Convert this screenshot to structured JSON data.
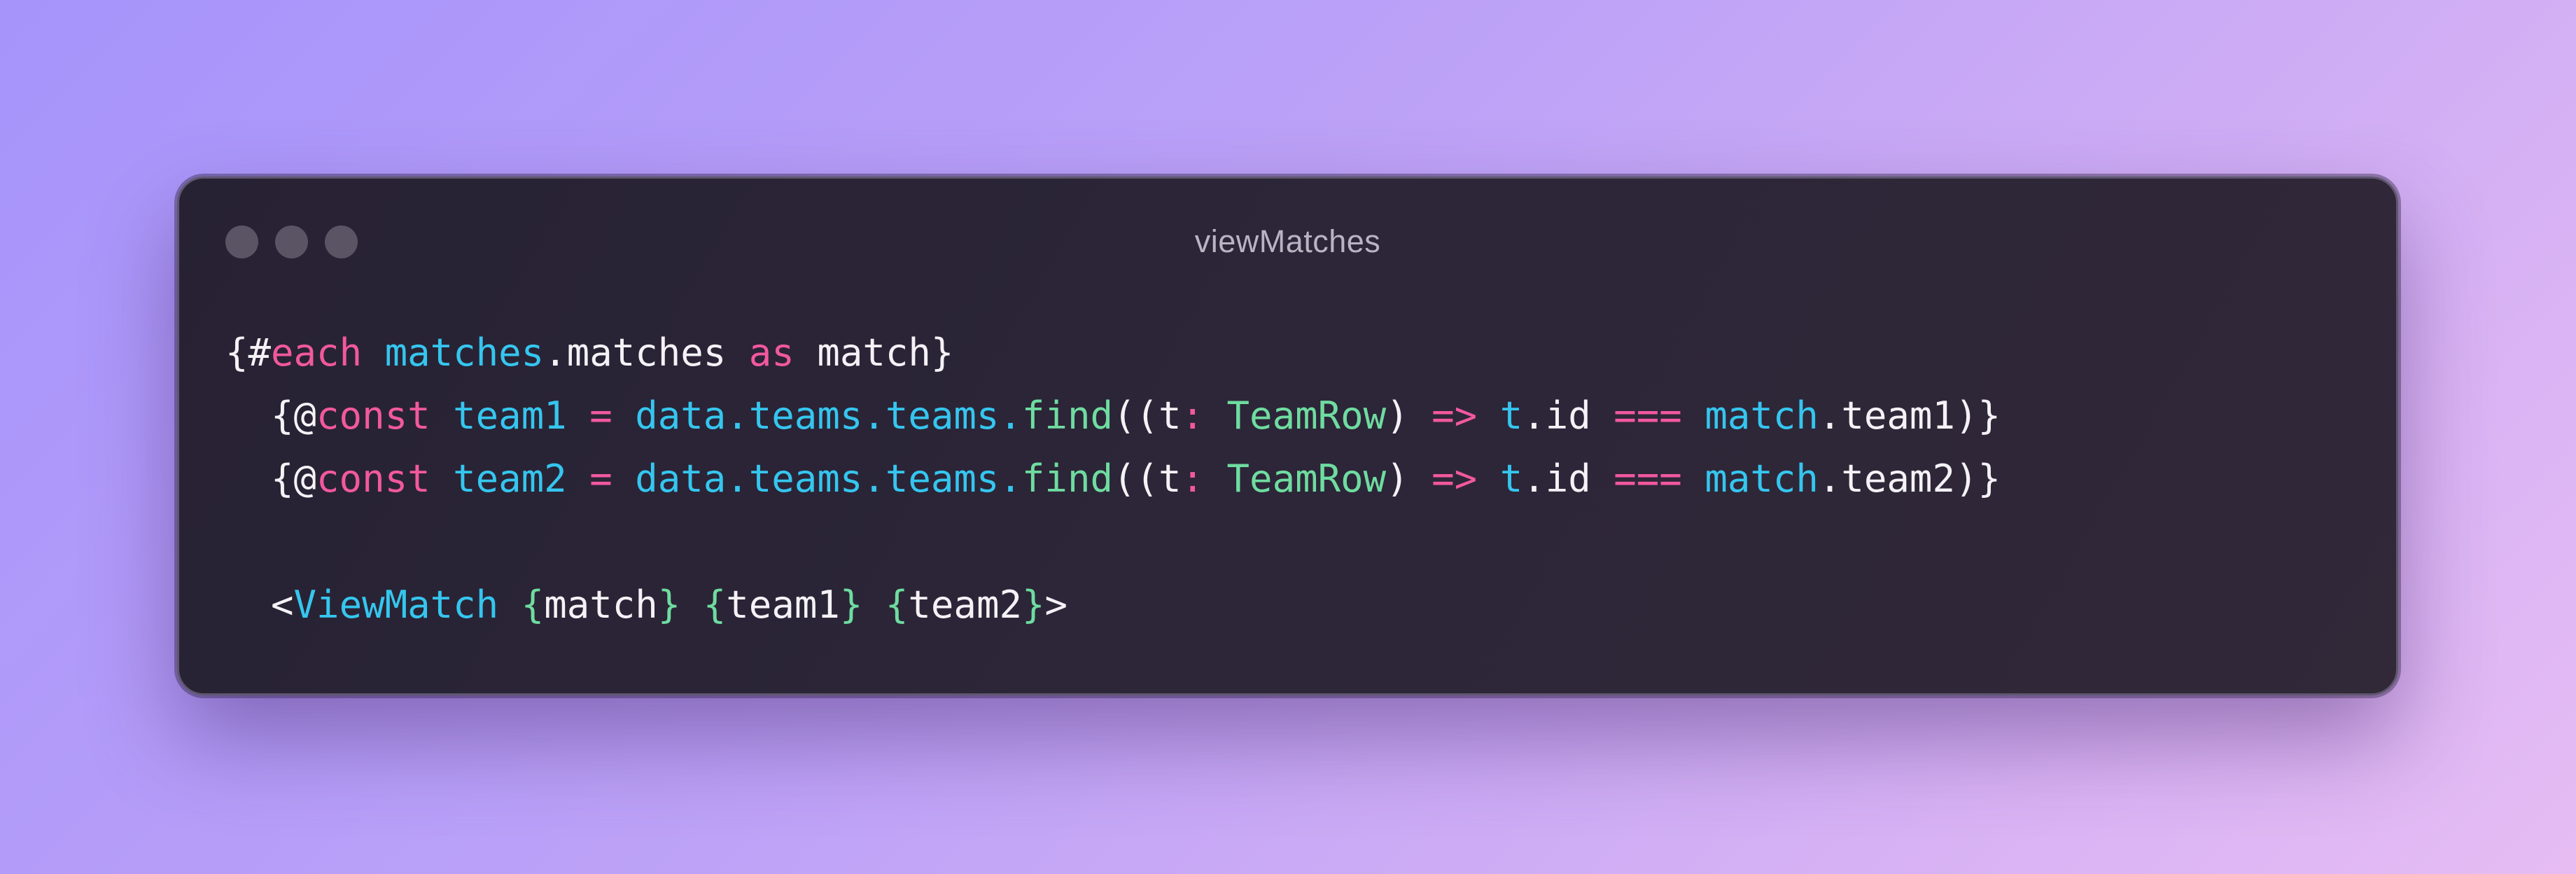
{
  "window": {
    "title": "viewMatches",
    "controls": [
      "close",
      "minimize",
      "maximize"
    ]
  },
  "colors": {
    "default": "#f4f2f6",
    "keyword": "#f2589f",
    "identifier": "#35c6ef",
    "type": "#6fdca0",
    "window_bg": "#2a2436",
    "page_gradient_start": "#a694fb",
    "page_gradient_end": "#e6bcf3"
  },
  "code": {
    "language": "svelte",
    "lines": [
      [
        {
          "text": "{#",
          "style": "default"
        },
        {
          "text": "each",
          "style": "pink"
        },
        {
          "text": " ",
          "style": "default"
        },
        {
          "text": "matches",
          "style": "cyan"
        },
        {
          "text": ".matches ",
          "style": "default"
        },
        {
          "text": "as",
          "style": "pink"
        },
        {
          "text": " match}",
          "style": "default"
        }
      ],
      [
        {
          "text": "  {@",
          "style": "default"
        },
        {
          "text": "const",
          "style": "pink"
        },
        {
          "text": " ",
          "style": "default"
        },
        {
          "text": "team1",
          "style": "cyan"
        },
        {
          "text": " ",
          "style": "default"
        },
        {
          "text": "=",
          "style": "pink"
        },
        {
          "text": " ",
          "style": "default"
        },
        {
          "text": "data.teams.teams.",
          "style": "cyan"
        },
        {
          "text": "find",
          "style": "green"
        },
        {
          "text": "((t",
          "style": "default"
        },
        {
          "text": ":",
          "style": "pink"
        },
        {
          "text": " ",
          "style": "default"
        },
        {
          "text": "TeamRow",
          "style": "green"
        },
        {
          "text": ") ",
          "style": "default"
        },
        {
          "text": "=>",
          "style": "pink"
        },
        {
          "text": " ",
          "style": "default"
        },
        {
          "text": "t",
          "style": "cyan"
        },
        {
          "text": ".id ",
          "style": "default"
        },
        {
          "text": "===",
          "style": "pink"
        },
        {
          "text": " ",
          "style": "default"
        },
        {
          "text": "match",
          "style": "cyan"
        },
        {
          "text": ".team1)}",
          "style": "default"
        }
      ],
      [
        {
          "text": "  {@",
          "style": "default"
        },
        {
          "text": "const",
          "style": "pink"
        },
        {
          "text": " ",
          "style": "default"
        },
        {
          "text": "team2",
          "style": "cyan"
        },
        {
          "text": " ",
          "style": "default"
        },
        {
          "text": "=",
          "style": "pink"
        },
        {
          "text": " ",
          "style": "default"
        },
        {
          "text": "data.teams.teams.",
          "style": "cyan"
        },
        {
          "text": "find",
          "style": "green"
        },
        {
          "text": "((t",
          "style": "default"
        },
        {
          "text": ":",
          "style": "pink"
        },
        {
          "text": " ",
          "style": "default"
        },
        {
          "text": "TeamRow",
          "style": "green"
        },
        {
          "text": ") ",
          "style": "default"
        },
        {
          "text": "=>",
          "style": "pink"
        },
        {
          "text": " ",
          "style": "default"
        },
        {
          "text": "t",
          "style": "cyan"
        },
        {
          "text": ".id ",
          "style": "default"
        },
        {
          "text": "===",
          "style": "pink"
        },
        {
          "text": " ",
          "style": "default"
        },
        {
          "text": "match",
          "style": "cyan"
        },
        {
          "text": ".team2)}",
          "style": "default"
        }
      ],
      [],
      [
        {
          "text": "  <",
          "style": "default"
        },
        {
          "text": "ViewMatch",
          "style": "cyan"
        },
        {
          "text": " ",
          "style": "default"
        },
        {
          "text": "{",
          "style": "green"
        },
        {
          "text": "match",
          "style": "default"
        },
        {
          "text": "}",
          "style": "green"
        },
        {
          "text": " ",
          "style": "default"
        },
        {
          "text": "{",
          "style": "green"
        },
        {
          "text": "team1",
          "style": "default"
        },
        {
          "text": "}",
          "style": "green"
        },
        {
          "text": " ",
          "style": "default"
        },
        {
          "text": "{",
          "style": "green"
        },
        {
          "text": "team2",
          "style": "default"
        },
        {
          "text": "}",
          "style": "green"
        },
        {
          "text": ">",
          "style": "default"
        }
      ]
    ]
  }
}
